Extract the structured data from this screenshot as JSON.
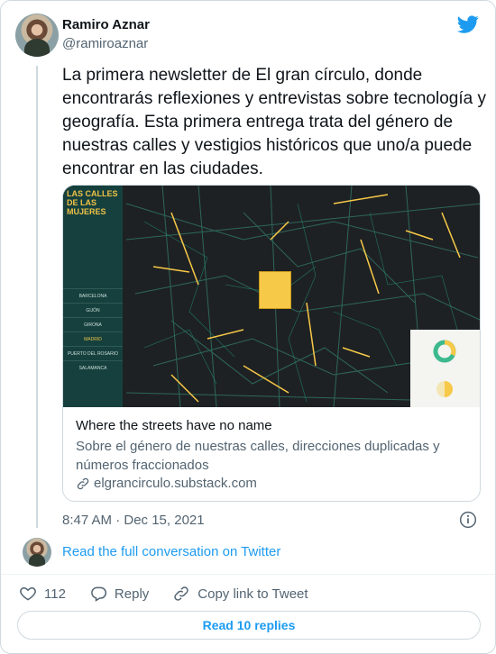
{
  "author": {
    "name": "Ramiro Aznar",
    "handle": "@ramiroaznar"
  },
  "tweet": {
    "text": "La primera newsletter de El gran círculo, donde encontrarás reflexiones y entrevistas sobre tecnología y geografía. Esta primera entrega trata del género de nuestras calles y vestigios históricos que uno/a puede encontrar en las ciudades.",
    "timestamp": "8:47 AM · Dec 15, 2021"
  },
  "link_card": {
    "title": "Where the streets have no name",
    "description": "Sobre el género de nuestras calles, direcciones duplicadas y números fraccionados",
    "domain": "elgrancirculo.substack.com",
    "preview": {
      "brand": "LAS CALLES DE LAS MUJERES",
      "cities": [
        "BARCELONA",
        "GIJÓN",
        "GIRONA",
        "MADRID",
        "PUERTO DEL ROSARIO",
        "SALAMANCA"
      ],
      "active_city": "MADRID",
      "accent_color": "#f7c948",
      "panel_color": "#16423f"
    }
  },
  "conversation_link": "Read the full conversation on Twitter",
  "actions": {
    "likes": "112",
    "reply": "Reply",
    "copy": "Copy link to Tweet"
  },
  "read_replies": "Read 10 replies",
  "colors": {
    "link_blue": "#1d9bf0",
    "muted": "#536471",
    "border": "#cfd9de"
  },
  "icons": {
    "logo": "twitter-bird-icon",
    "info": "info-icon",
    "link": "link-icon",
    "like": "heart-icon",
    "reply": "speech-bubble-icon",
    "copy": "copy-link-icon"
  }
}
